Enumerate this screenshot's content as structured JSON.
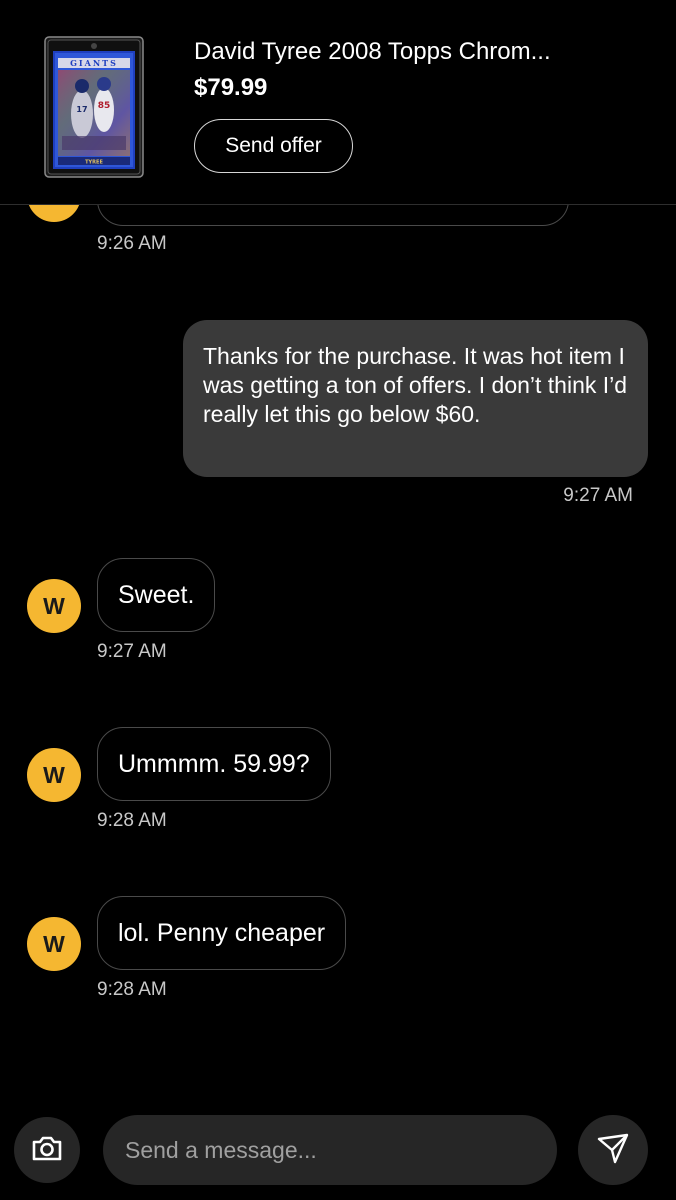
{
  "listing": {
    "title": "David Tyree 2008 Topps Chrom...",
    "price": "$79.99",
    "offer_label": "Send offer",
    "card_team_text": "GIANTS",
    "card_player_text": "TYREE"
  },
  "messages": [
    {
      "id": "partial",
      "from": "seller",
      "time": "9:26 AM"
    },
    {
      "id": "m1",
      "from": "me",
      "text": "Thanks for the purchase. It was hot item I was getting a ton of offers. I don’t think I’d really let this go below $60.",
      "time": "9:27 AM"
    },
    {
      "id": "m2",
      "from": "seller",
      "avatar": "W",
      "text": "Sweet.",
      "time": "9:27 AM"
    },
    {
      "id": "m3",
      "from": "seller",
      "avatar": "W",
      "text": "Ummmm. 59.99?",
      "time": "9:28 AM"
    },
    {
      "id": "m4",
      "from": "seller",
      "avatar": "W",
      "text": "lol. Penny cheaper",
      "time": "9:28 AM"
    }
  ],
  "composer": {
    "placeholder": "Send a message...",
    "camera_icon": "camera-icon",
    "send_icon": "send-icon"
  },
  "colors": {
    "background": "#000000",
    "avatar": "#f5b731",
    "outgoing_bubble": "#3a3a3a",
    "input_bg": "#262626"
  }
}
